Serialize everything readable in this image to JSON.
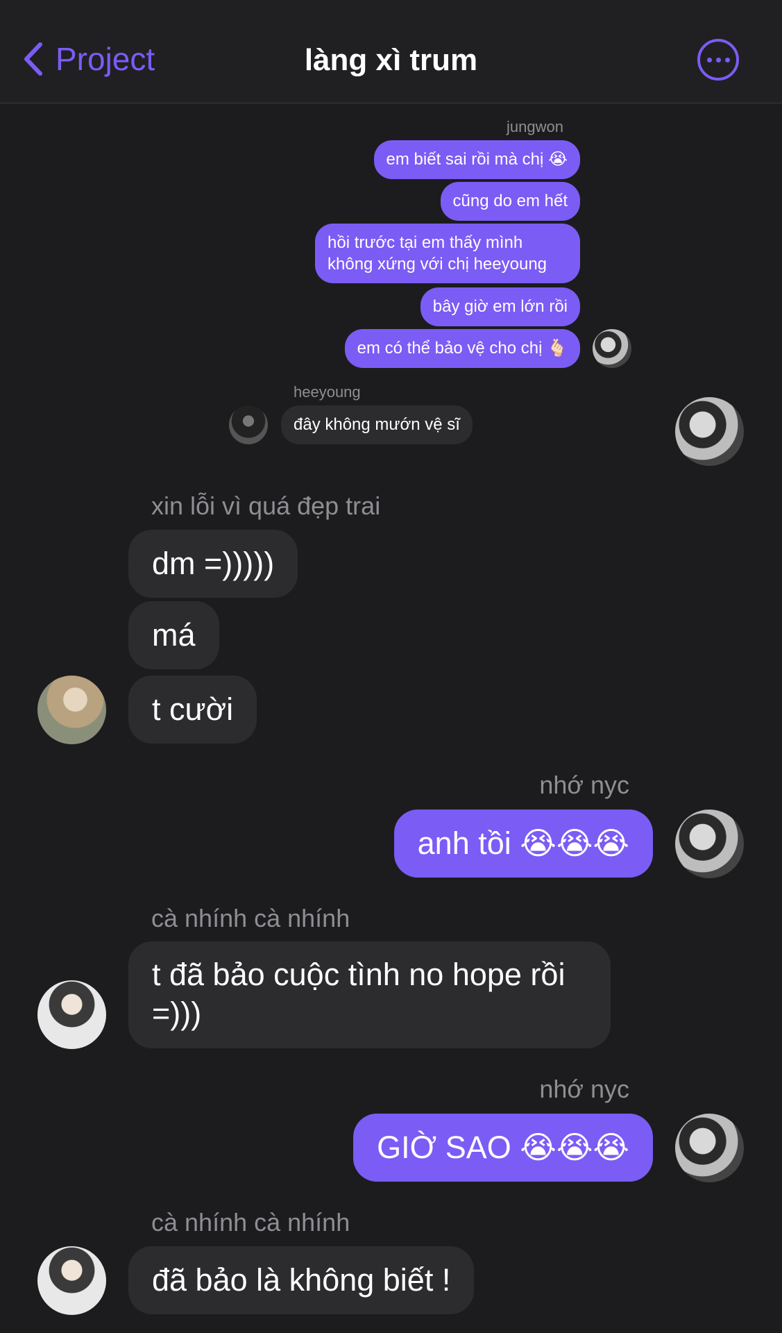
{
  "header": {
    "back_label": "Project",
    "title": "làng xì trum",
    "accent_color": "#7b5cf5",
    "more_icon": "more-horizontal-icon"
  },
  "screenshot": {
    "jungwon_name": "jungwon",
    "jungwon_messages": [
      "em biết sai rồi mà chị 😭",
      "cũng do em hết",
      "hồi trước tại em thấy mình không xứng với chị heeyoung",
      "bây giờ em lớn rồi",
      "em có thể bảo vệ cho chị 🫰🏻"
    ],
    "heeyoung_name": "heeyoung",
    "heeyoung_message": "đây không mướn vệ sĩ"
  },
  "messages": {
    "sender_1": "xin lỗi vì quá đẹp trai",
    "group_1": [
      "dm =)))))",
      "má",
      "t cười"
    ],
    "sender_2": "nhớ nyc",
    "msg_2": "anh tồi 😭😭😭",
    "sender_3": "cà nhính cà nhính",
    "msg_3": "t đã bảo cuộc tình no hope rồi =)))",
    "sender_4": "nhớ nyc",
    "msg_4": "GIỜ SAO 😭😭😭",
    "sender_5": "cà nhính cà nhính",
    "msg_5": "đã bảo là không biết !"
  }
}
